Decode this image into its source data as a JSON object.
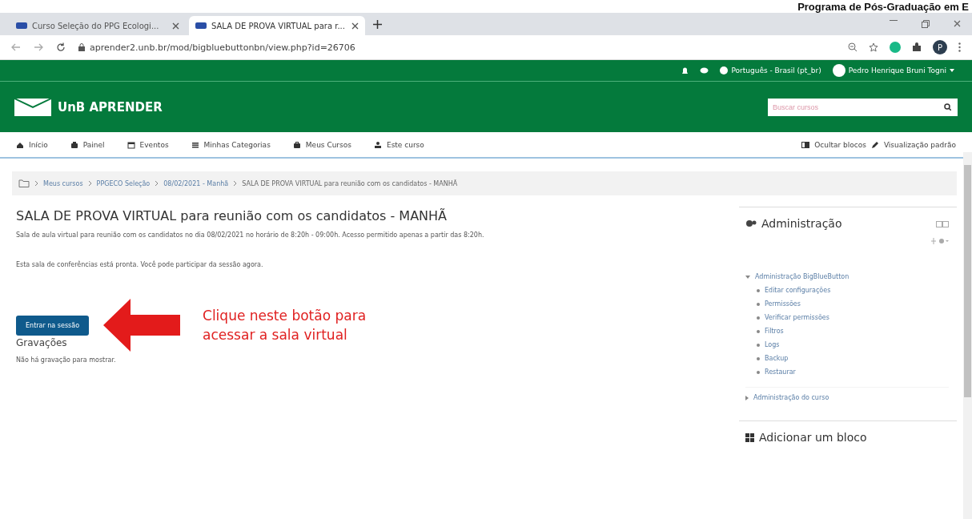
{
  "overlay_heading": "Programa de Pós-Graduação em E",
  "browser": {
    "tabs": [
      {
        "title": "Curso Seleção do PPG Ecologi...",
        "selected": false
      },
      {
        "title": "SALA DE PROVA VIRTUAL para r...",
        "selected": true
      }
    ],
    "address": "aprender2.unb.br/mod/bigbluebuttonbn/view.php?id=26706",
    "profile_initial": "P"
  },
  "topbar": {
    "language": "Português - Brasil (pt_br)",
    "user": "Pedro Henrique Bruni Togni"
  },
  "site": {
    "name": "UnB APRENDER",
    "search_placeholder": "Buscar cursos"
  },
  "nav": {
    "items": [
      {
        "label": "Início"
      },
      {
        "label": "Painel"
      },
      {
        "label": "Eventos"
      },
      {
        "label": "Minhas Categorias"
      },
      {
        "label": "Meus Cursos"
      },
      {
        "label": "Este curso"
      }
    ],
    "right": [
      {
        "label": "Ocultar blocos"
      },
      {
        "label": "Visualização padrão"
      }
    ]
  },
  "breadcrumb": [
    "Meus cursos",
    "PPGECO Seleção",
    "08/02/2021 - Manhã",
    "SALA DE PROVA VIRTUAL para reunião com os candidatos - MANHÃ"
  ],
  "page": {
    "title": "SALA DE PROVA VIRTUAL para reunião com os candidatos - MANHÃ",
    "description": "Sala de aula virtual para reunião com os candidatos no dia 08/02/2021 no horário de 8:20h - 09:00h. Acesso permitido apenas a partir das 8:20h.",
    "status": "Esta sala de conferências está pronta. Você pode participar da sessão agora.",
    "join_button": "Entrar na sessão",
    "annotation": [
      "Clique neste botão para",
      "acessar a sala virtual"
    ],
    "recordings_heading": "Gravações",
    "recordings_empty": "Não há gravação para mostrar."
  },
  "admin_block": {
    "title": "Administração",
    "tree": [
      {
        "label": "Administração BigBlueButton",
        "expanded": true,
        "children": [
          {
            "label": "Editar configurações"
          },
          {
            "label": "Permissões"
          },
          {
            "label": "Verificar permissões"
          },
          {
            "label": "Filtros"
          },
          {
            "label": "Logs"
          },
          {
            "label": "Backup"
          },
          {
            "label": "Restaurar"
          }
        ]
      },
      {
        "label": "Administração do curso",
        "expanded": false
      }
    ]
  },
  "add_block": {
    "title": "Adicionar um bloco"
  }
}
